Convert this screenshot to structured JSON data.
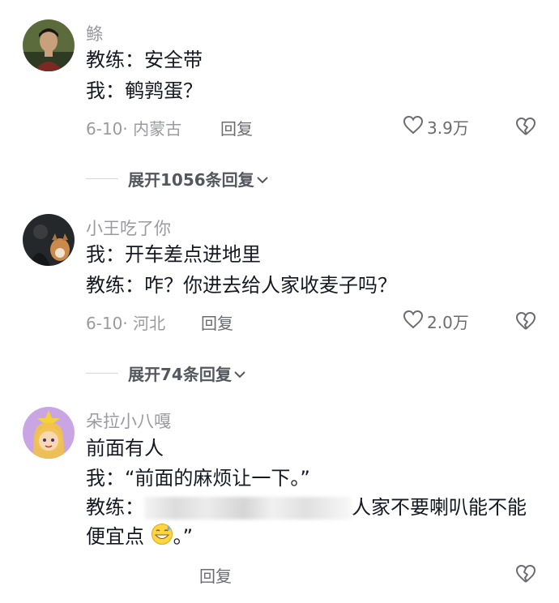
{
  "comments": [
    {
      "username": "鲦",
      "lines": [
        "教练：安全带",
        "我：鹌鹑蛋？"
      ],
      "meta": "6-10· 内蒙古",
      "reply_label": "回复",
      "likes": "3.9万",
      "expand_label": "展开1056条回复"
    },
    {
      "username": "小王吃了你",
      "lines": [
        "我：开车差点进地里",
        "教练：咋？你进去给人家收麦子吗？"
      ],
      "meta": "6-10· 河北",
      "reply_label": "回复",
      "likes": "2.0万",
      "expand_label": "展开74条回复"
    },
    {
      "username": "朵拉小八嘎",
      "lines": [
        "前面有人",
        "我：“前面的麻烦让一下。”",
        "人家不要喇叭能不能",
        "便宜点",
        "。”"
      ],
      "line_prefixes": [
        "",
        "",
        "教练：",
        "",
        ""
      ],
      "reply_label": "回复"
    }
  ],
  "icons": {
    "like": "heart-outline-icon",
    "dislike": "broken-heart-icon",
    "expand": "chevron-down-icon",
    "emoji": "grinning-sweat-emoji"
  },
  "colors": {
    "text": "#161823",
    "muted": "#9a9ba1",
    "secondary": "#6b6c73"
  }
}
